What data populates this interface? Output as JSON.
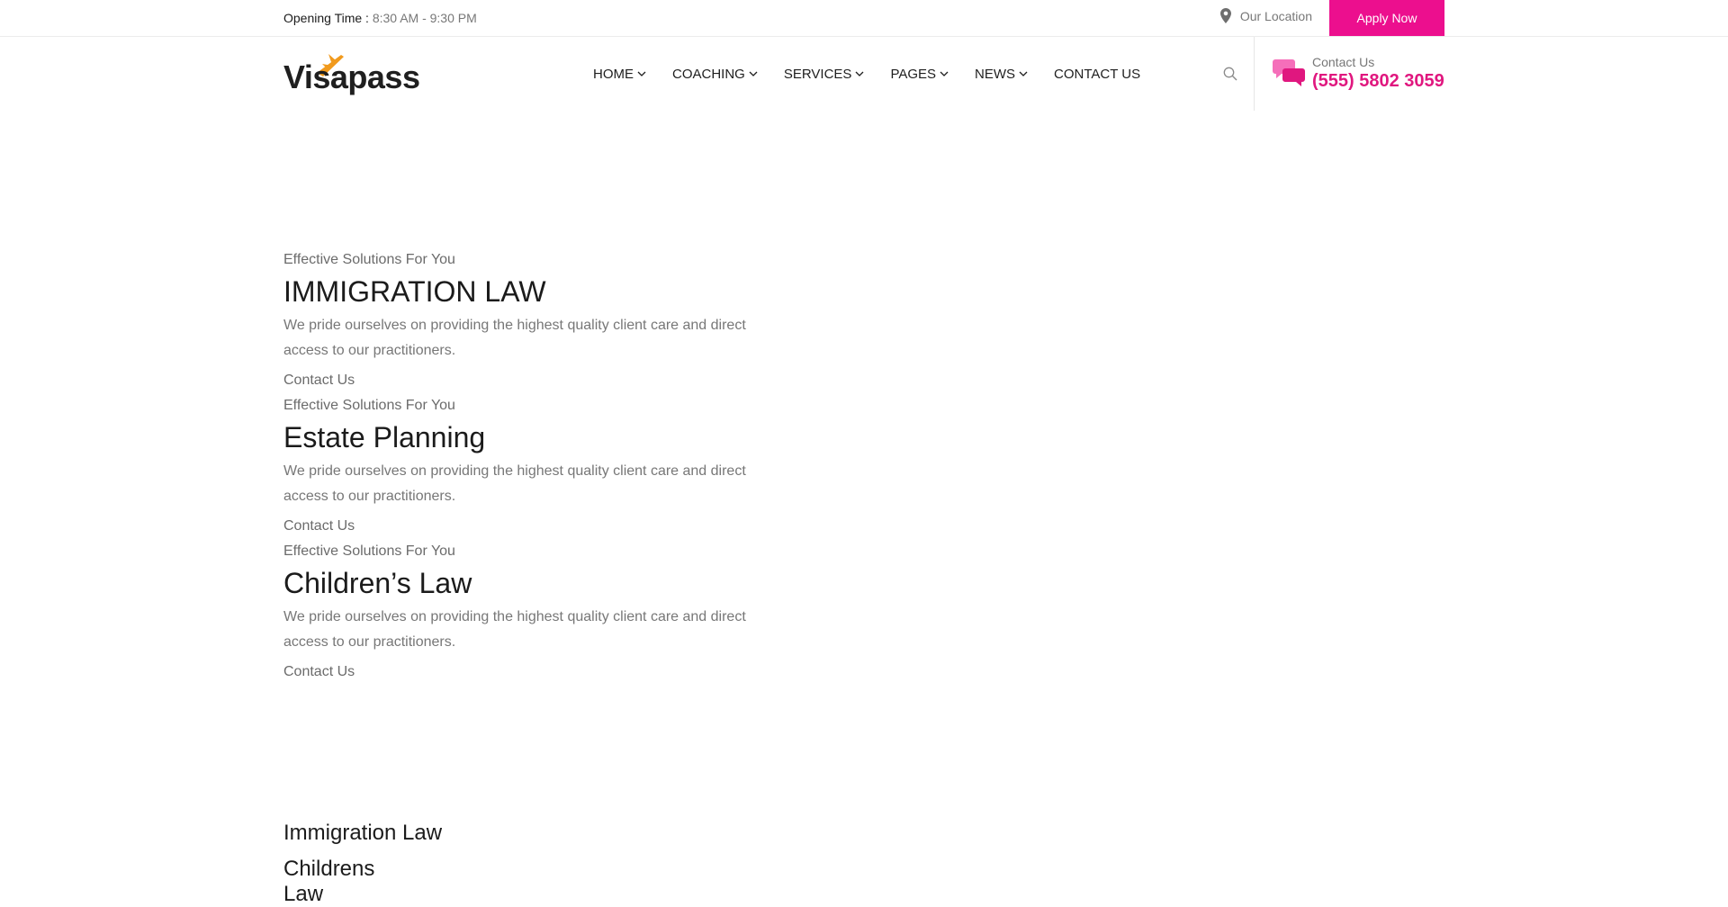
{
  "topbar": {
    "opening_label": "Opening Time :",
    "opening_hours": "8:30 AM - 9:30 PM",
    "location_label": "Our Location",
    "apply_label": "Apply Now"
  },
  "header": {
    "logo_text": "Visapass",
    "nav": [
      {
        "label": "HOME",
        "has_dropdown": true
      },
      {
        "label": "COACHING",
        "has_dropdown": true
      },
      {
        "label": "SERVICES",
        "has_dropdown": true
      },
      {
        "label": "PAGES",
        "has_dropdown": true
      },
      {
        "label": "NEWS",
        "has_dropdown": true
      },
      {
        "label": "CONTACT US",
        "has_dropdown": false
      }
    ],
    "contact_label": "Contact Us",
    "contact_phone": "(555) 5802 3059",
    "icons": {
      "search": "search-icon",
      "contact": "chat-bubbles-icon",
      "location": "map-pin-icon"
    }
  },
  "slides": [
    {
      "subtitle": "Effective Solutions For You",
      "title": "IMMIGRATION LAW",
      "text": "We pride ourselves on providing the highest quality client care and direct access to our practitioners.",
      "link": "Contact Us"
    },
    {
      "subtitle": "Effective Solutions For You",
      "title": "Estate Planning",
      "text": "We pride ourselves on providing the highest quality client care and direct access to our practitioners.",
      "link": "Contact Us"
    },
    {
      "subtitle": "Effective Solutions For You",
      "title": "Children’s Law",
      "text": "We pride ourselves on providing the highest quality client care and direct access to our practitioners.",
      "link": "Contact Us"
    }
  ],
  "bottom_items": [
    "Immigration Law",
    "Childrens Law"
  ],
  "colors": {
    "accent": "#ec0f8e",
    "phone": "#e0177f",
    "logo_plane": "#f19a1d",
    "heading": "#1b1b1b",
    "text": "#777777"
  }
}
